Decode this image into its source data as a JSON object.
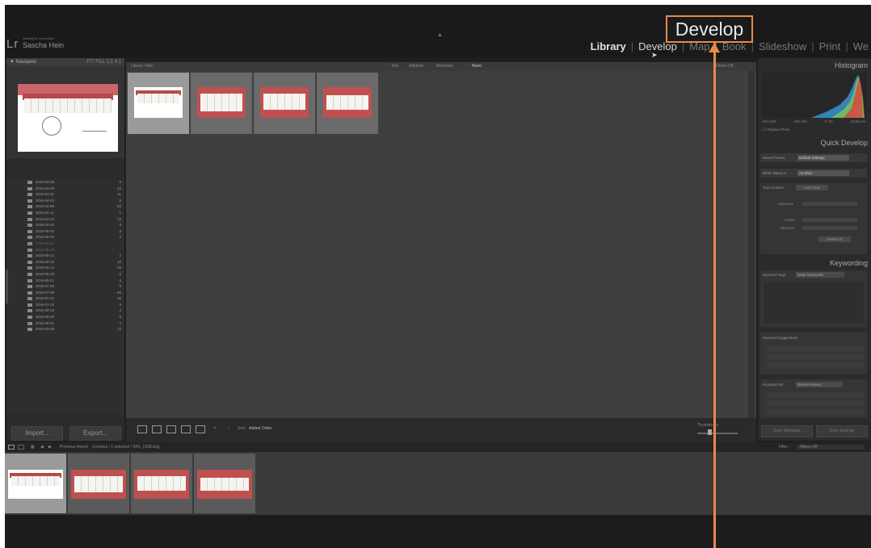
{
  "app": {
    "logo": "Lr",
    "status": "Waiting for connection",
    "user": "Sascha Hein"
  },
  "modules": [
    "Library",
    "Develop",
    "Map",
    "Book",
    "Slideshow",
    "Print",
    "We"
  ],
  "active_module": "Library",
  "callout": "Develop",
  "left_panel": {
    "navigator_title": "Navigator",
    "navigator_zoom": "FIT  FILL  1:1  4:1",
    "folders": [
      {
        "name": "2016-03-28",
        "count": "8"
      },
      {
        "name": "2016-03-30",
        "count": "24"
      },
      {
        "name": "2016-03-31",
        "count": "11"
      },
      {
        "name": "2016-04-01",
        "count": "5"
      },
      {
        "name": "2016-04-09",
        "count": "60"
      },
      {
        "name": "2016-04-11",
        "count": "1"
      },
      {
        "name": "2016-04-24",
        "count": "13"
      },
      {
        "name": "2016-04-30",
        "count": "8"
      },
      {
        "name": "2016-05-02",
        "count": "3"
      },
      {
        "name": "2016-05-04",
        "count": "3"
      },
      {
        "name": "2016-05-05",
        "count": ""
      },
      {
        "name": "2016-05-10",
        "count": ""
      },
      {
        "name": "2016-05-12",
        "count": "2"
      },
      {
        "name": "2016-05-13",
        "count": "12"
      },
      {
        "name": "2016-05-14",
        "count": "29"
      },
      {
        "name": "2016-05-23",
        "count": "6"
      },
      {
        "name": "2016-06-21",
        "count": "4"
      },
      {
        "name": "2016-07-08",
        "count": "9"
      },
      {
        "name": "2016-07-09",
        "count": "60"
      },
      {
        "name": "2016-07-22",
        "count": "10"
      },
      {
        "name": "2016-07-23",
        "count": "4"
      },
      {
        "name": "2016-08-18",
        "count": "2"
      },
      {
        "name": "2016-08-29",
        "count": "6"
      },
      {
        "name": "2016-09-01",
        "count": "2"
      },
      {
        "name": "2016-09-08",
        "count": "12"
      }
    ],
    "import_label": "Import...",
    "export_label": "Export..."
  },
  "filter_bar": {
    "label": "Library Filter :",
    "options": [
      "Text",
      "Attribute",
      "Metadata",
      "None"
    ],
    "selected": "None",
    "right": "Filters Off"
  },
  "toolbar": {
    "sort_label": "Sort:",
    "sort_value": "Added Order",
    "thumbnails_label": "Thumbnails"
  },
  "right_panel": {
    "histogram_title": "Histogram",
    "camera_info": [
      "ISO 100",
      "105 mm",
      "f / 22",
      "1/125 sec"
    ],
    "original_photo": "Original Photo",
    "quick_develop_title": "Quick Develop",
    "saved_preset_label": "Saved Preset",
    "saved_preset_value": "Default Settings",
    "white_balance_label": "White Balance",
    "white_balance_value": "As Shot",
    "tone_control_label": "Tone Control",
    "tone_control_value": "Auto Tone",
    "exposure_label": "Exposure",
    "clarity_label": "Clarity",
    "vibrance_label": "Vibrance",
    "reset_all": "Reset All",
    "keywording_title": "Keywording",
    "keyword_tags_label": "Keyword Tags",
    "keyword_tags_value": "Enter Keywords",
    "keyword_suggestions_label": "Keyword Suggestions",
    "keyword_set_label": "Keyword Set",
    "keyword_set_value": "Recent Keywo...",
    "sync_metadata": "Sync Metadata",
    "sync_settings": "Sync Settings"
  },
  "filmstrip_bar": {
    "source": "Previous Import",
    "summary": "4 photos / 1 selected / IMG_1938.dng",
    "filter_label": "Filter :",
    "filter_value": "Filters Off"
  },
  "colors": {
    "accent": "#e8894a"
  }
}
